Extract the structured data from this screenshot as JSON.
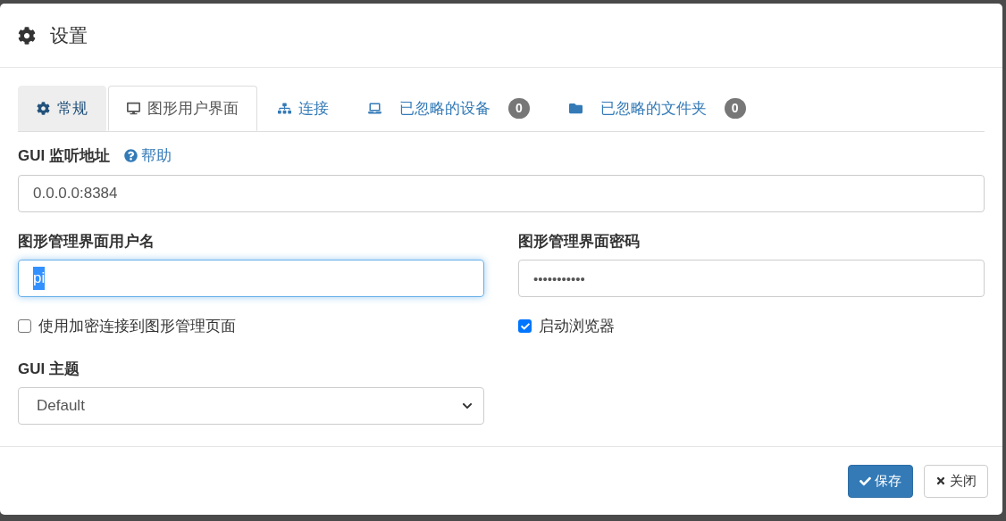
{
  "dialog": {
    "title": "设置"
  },
  "tabs": [
    {
      "label": "常规",
      "kind": "gear",
      "selected": false,
      "hovered": true
    },
    {
      "label": "图形用户界面",
      "kind": "desktop",
      "selected": true
    },
    {
      "label": "连接",
      "kind": "sitemap",
      "selected": false,
      "hovered": false
    },
    {
      "label": "已忽略的设备",
      "kind": "laptop",
      "selected": false,
      "hovered": false,
      "badge": "0"
    },
    {
      "label": "已忽略的文件夹",
      "kind": "folder",
      "selected": false,
      "hovered": false,
      "badge": "0"
    }
  ],
  "listen_address": {
    "label": "GUI 监听地址",
    "help": "帮助",
    "value": "0.0.0.0:8384"
  },
  "username": {
    "label": "图形管理界面用户名",
    "value": "pi",
    "focused": true
  },
  "password": {
    "label": "图形管理界面密码",
    "value": "•••••••••••"
  },
  "checkboxes": [
    {
      "label": "使用加密连接到图形管理页面",
      "checked": false
    },
    {
      "label": "启动浏览器",
      "checked": true
    }
  ],
  "theme": {
    "label": "GUI 主题",
    "value": "Default"
  },
  "buttons": [
    {
      "label": "保存",
      "kind": "primary"
    },
    {
      "label": "关闭",
      "kind": "default"
    }
  ]
}
